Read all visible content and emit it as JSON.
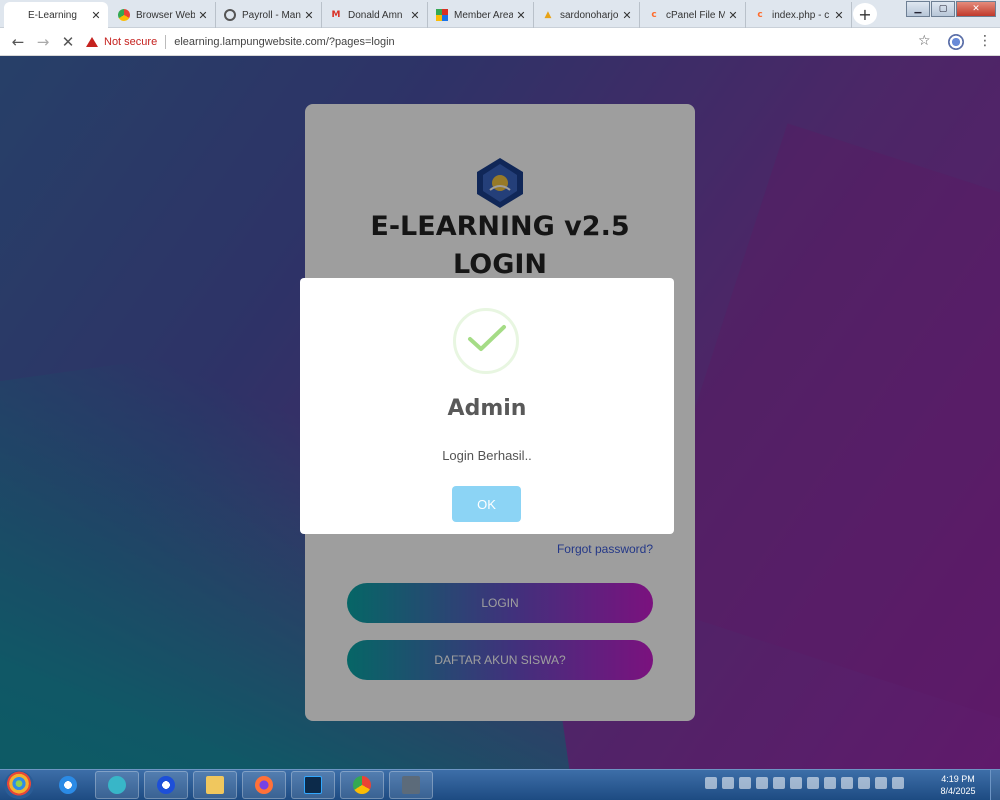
{
  "browser": {
    "tabs": [
      {
        "title": "E-Learning",
        "icon": "page-icon",
        "active": true
      },
      {
        "title": "Browser Web",
        "icon": "chrome-icon"
      },
      {
        "title": "Payroll - Man",
        "icon": "globe-icon"
      },
      {
        "title": "Donald Amn",
        "icon": "gmail-icon"
      },
      {
        "title": "Member Area",
        "icon": "grid-icon"
      },
      {
        "title": "sardonoharjo",
        "icon": "sardono-icon"
      },
      {
        "title": "cPanel File M",
        "icon": "cpanel-icon"
      },
      {
        "title": "index.php - c",
        "icon": "cpanel-icon"
      }
    ],
    "new_tab_label": "+",
    "security_label": "Not secure",
    "url": "elearning.lampungwebsite.com/?pages=login"
  },
  "login_card": {
    "title_line1": "E-LEARNING v2.5",
    "title_line2": "LOGIN",
    "forgot_password": "Forgot password?",
    "login_button": "LOGIN",
    "register_button": "DAFTAR AKUN SISWA?"
  },
  "modal": {
    "title": "Admin",
    "message": "Login Berhasil..",
    "ok_label": "OK",
    "success_color": "#a5dc86",
    "ok_color": "#8cd4f5"
  },
  "taskbar": {
    "apps": [
      "start",
      "internet-explorer",
      "app-s",
      "app-blue",
      "file-explorer",
      "firefox",
      "photoshop",
      "chrome",
      "app-terminal"
    ],
    "clock_time": "4:19 PM",
    "clock_date": "8/4/2025"
  }
}
